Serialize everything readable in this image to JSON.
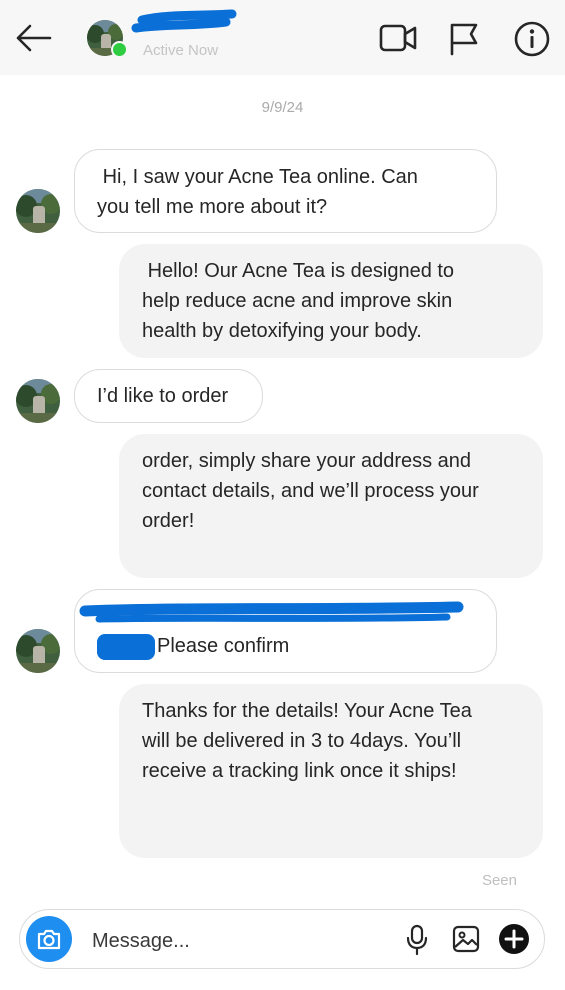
{
  "header": {
    "status": "Active Now",
    "icons": [
      "back-arrow-icon",
      "video-camera-icon",
      "flag-icon",
      "info-icon"
    ]
  },
  "conversation": {
    "date": "9/9/24",
    "messages": [
      {
        "direction": "incoming",
        "text": " Hi, I saw your Acne Tea online. Can\nyou tell me more about it?"
      },
      {
        "direction": "outgoing",
        "text": " Hello! Our Acne Tea is designed to\nhelp reduce acne and improve skin\nhealth by detoxifying your body."
      },
      {
        "direction": "incoming",
        "text": "I’d like to order"
      },
      {
        "direction": "outgoing",
        "text": "order, simply share your address and\ncontact details, and we’ll process your\norder!"
      },
      {
        "direction": "incoming",
        "text": "Please confirm"
      },
      {
        "direction": "outgoing",
        "text": "Thanks for the details! Your Acne Tea\nwill be delivered in 3 to 4days. You’ll\nreceive a tracking link once it ships!"
      }
    ],
    "seen": "Seen"
  },
  "composer": {
    "placeholder": "Message...",
    "icons": [
      "camera-icon",
      "microphone-icon",
      "image-icon",
      "plus-icon"
    ]
  },
  "colors": {
    "header_bg": "#f7f7f7",
    "outgoing_bubble": "#f3f3f3",
    "incoming_bubble": "#ffffff",
    "bubble_border": "#dbdbdb",
    "online_dot": "#2ecc40",
    "camera_button": "#1f8ef1",
    "redaction": "#0a6fd6"
  }
}
